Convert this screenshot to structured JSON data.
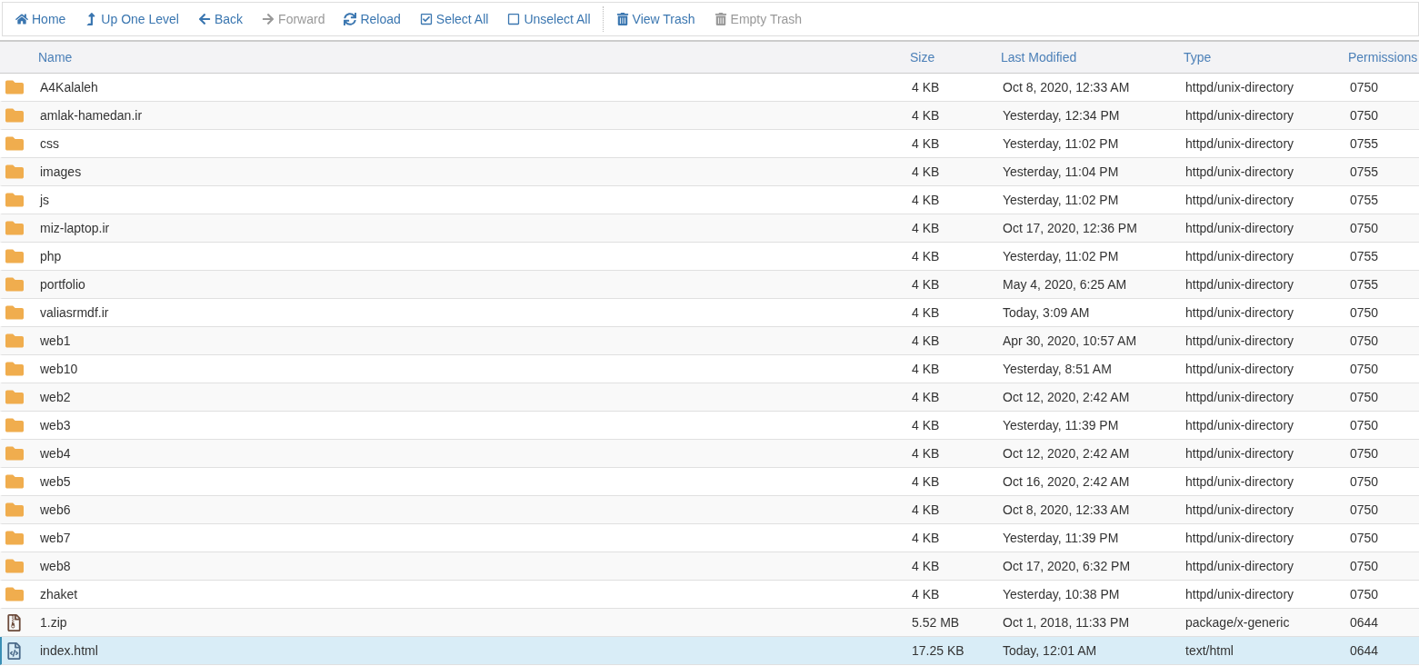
{
  "toolbar": [
    {
      "kind": "home",
      "label": "Home",
      "disabled": false
    },
    {
      "kind": "up",
      "label": "Up One Level",
      "disabled": false
    },
    {
      "kind": "back",
      "label": "Back",
      "disabled": false
    },
    {
      "kind": "forward",
      "label": "Forward",
      "disabled": true
    },
    {
      "kind": "reload",
      "label": "Reload",
      "disabled": false
    },
    {
      "kind": "select",
      "label": "Select All",
      "disabled": false
    },
    {
      "kind": "unselect",
      "label": "Unselect All",
      "disabled": false
    },
    {
      "kind": "trash",
      "label": "View Trash",
      "disabled": false
    },
    {
      "kind": "trash",
      "label": "Empty Trash",
      "disabled": true
    }
  ],
  "table": {
    "columns": [
      "Name",
      "Size",
      "Last Modified",
      "Type",
      "Permissions"
    ],
    "rows": [
      {
        "kind": "folder",
        "name": "A4Kalaleh",
        "size": "4 KB",
        "modified": "Oct 8, 2020, 12:33 AM",
        "type": "httpd/unix-directory",
        "permissions": "0750",
        "selected": false
      },
      {
        "kind": "folder",
        "name": "amlak-hamedan.ir",
        "size": "4 KB",
        "modified": "Yesterday, 12:34 PM",
        "type": "httpd/unix-directory",
        "permissions": "0750",
        "selected": false
      },
      {
        "kind": "folder",
        "name": "css",
        "size": "4 KB",
        "modified": "Yesterday, 11:02 PM",
        "type": "httpd/unix-directory",
        "permissions": "0755",
        "selected": false
      },
      {
        "kind": "folder",
        "name": "images",
        "size": "4 KB",
        "modified": "Yesterday, 11:04 PM",
        "type": "httpd/unix-directory",
        "permissions": "0755",
        "selected": false
      },
      {
        "kind": "folder",
        "name": "js",
        "size": "4 KB",
        "modified": "Yesterday, 11:02 PM",
        "type": "httpd/unix-directory",
        "permissions": "0755",
        "selected": false
      },
      {
        "kind": "folder",
        "name": "miz-laptop.ir",
        "size": "4 KB",
        "modified": "Oct 17, 2020, 12:36 PM",
        "type": "httpd/unix-directory",
        "permissions": "0750",
        "selected": false
      },
      {
        "kind": "folder",
        "name": "php",
        "size": "4 KB",
        "modified": "Yesterday, 11:02 PM",
        "type": "httpd/unix-directory",
        "permissions": "0755",
        "selected": false
      },
      {
        "kind": "folder",
        "name": "portfolio",
        "size": "4 KB",
        "modified": "May 4, 2020, 6:25 AM",
        "type": "httpd/unix-directory",
        "permissions": "0755",
        "selected": false
      },
      {
        "kind": "folder",
        "name": "valiasrmdf.ir",
        "size": "4 KB",
        "modified": "Today, 3:09 AM",
        "type": "httpd/unix-directory",
        "permissions": "0750",
        "selected": false
      },
      {
        "kind": "folder",
        "name": "web1",
        "size": "4 KB",
        "modified": "Apr 30, 2020, 10:57 AM",
        "type": "httpd/unix-directory",
        "permissions": "0750",
        "selected": false
      },
      {
        "kind": "folder",
        "name": "web10",
        "size": "4 KB",
        "modified": "Yesterday, 8:51 AM",
        "type": "httpd/unix-directory",
        "permissions": "0750",
        "selected": false
      },
      {
        "kind": "folder",
        "name": "web2",
        "size": "4 KB",
        "modified": "Oct 12, 2020, 2:42 AM",
        "type": "httpd/unix-directory",
        "permissions": "0750",
        "selected": false
      },
      {
        "kind": "folder",
        "name": "web3",
        "size": "4 KB",
        "modified": "Yesterday, 11:39 PM",
        "type": "httpd/unix-directory",
        "permissions": "0750",
        "selected": false
      },
      {
        "kind": "folder",
        "name": "web4",
        "size": "4 KB",
        "modified": "Oct 12, 2020, 2:42 AM",
        "type": "httpd/unix-directory",
        "permissions": "0750",
        "selected": false
      },
      {
        "kind": "folder",
        "name": "web5",
        "size": "4 KB",
        "modified": "Oct 16, 2020, 2:42 AM",
        "type": "httpd/unix-directory",
        "permissions": "0750",
        "selected": false
      },
      {
        "kind": "folder",
        "name": "web6",
        "size": "4 KB",
        "modified": "Oct 8, 2020, 12:33 AM",
        "type": "httpd/unix-directory",
        "permissions": "0750",
        "selected": false
      },
      {
        "kind": "folder",
        "name": "web7",
        "size": "4 KB",
        "modified": "Yesterday, 11:39 PM",
        "type": "httpd/unix-directory",
        "permissions": "0750",
        "selected": false
      },
      {
        "kind": "folder",
        "name": "web8",
        "size": "4 KB",
        "modified": "Oct 17, 2020, 6:32 PM",
        "type": "httpd/unix-directory",
        "permissions": "0750",
        "selected": false
      },
      {
        "kind": "folder",
        "name": "zhaket",
        "size": "4 KB",
        "modified": "Yesterday, 10:38 PM",
        "type": "httpd/unix-directory",
        "permissions": "0750",
        "selected": false
      },
      {
        "kind": "zip",
        "name": "1.zip",
        "size": "5.52 MB",
        "modified": "Oct 1, 2018, 11:33 PM",
        "type": "package/x-generic",
        "permissions": "0644",
        "selected": false
      },
      {
        "kind": "html",
        "name": "index.html",
        "size": "17.25 KB",
        "modified": "Today, 12:01 AM",
        "type": "text/html",
        "permissions": "0644",
        "selected": true
      }
    ]
  }
}
